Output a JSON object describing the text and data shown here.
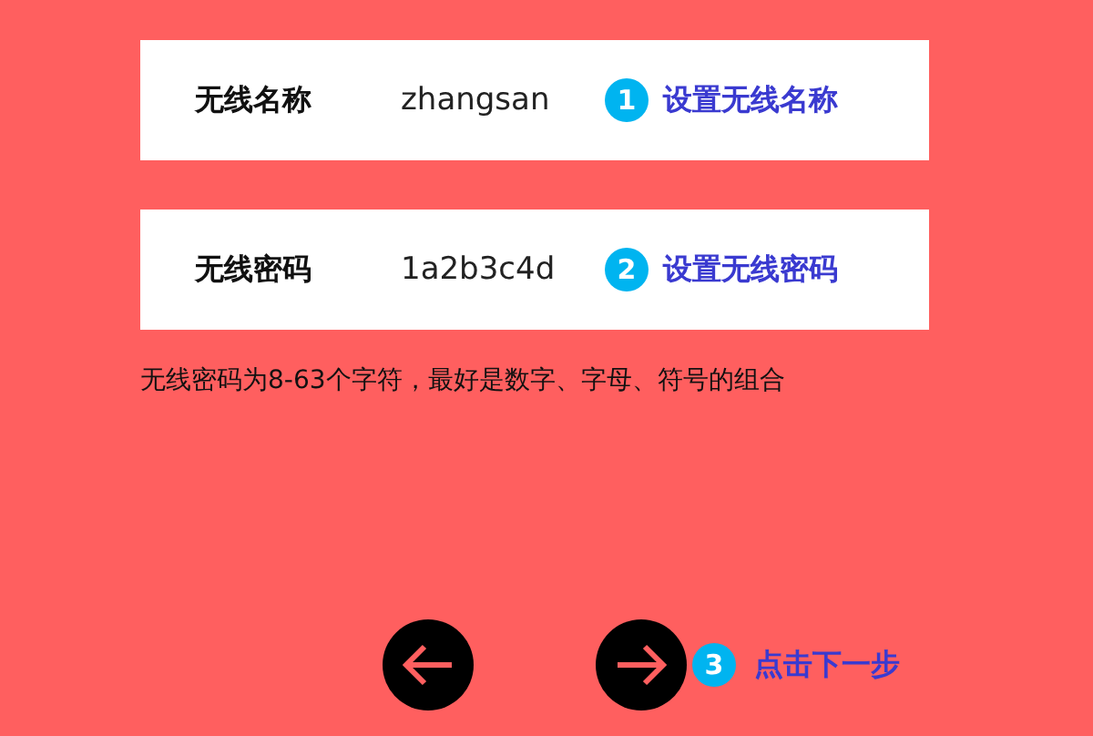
{
  "fields": [
    {
      "label": "无线名称",
      "value": "zhangsan",
      "step": {
        "number": "1",
        "text": "设置无线名称"
      }
    },
    {
      "label": "无线密码",
      "value": "1a2b3c4d",
      "step": {
        "number": "2",
        "text": "设置无线密码"
      }
    }
  ],
  "hint": "无线密码为8-63个字符，最好是数字、字母、符号的组合",
  "next_step": {
    "number": "3",
    "text": "点击下一步"
  }
}
